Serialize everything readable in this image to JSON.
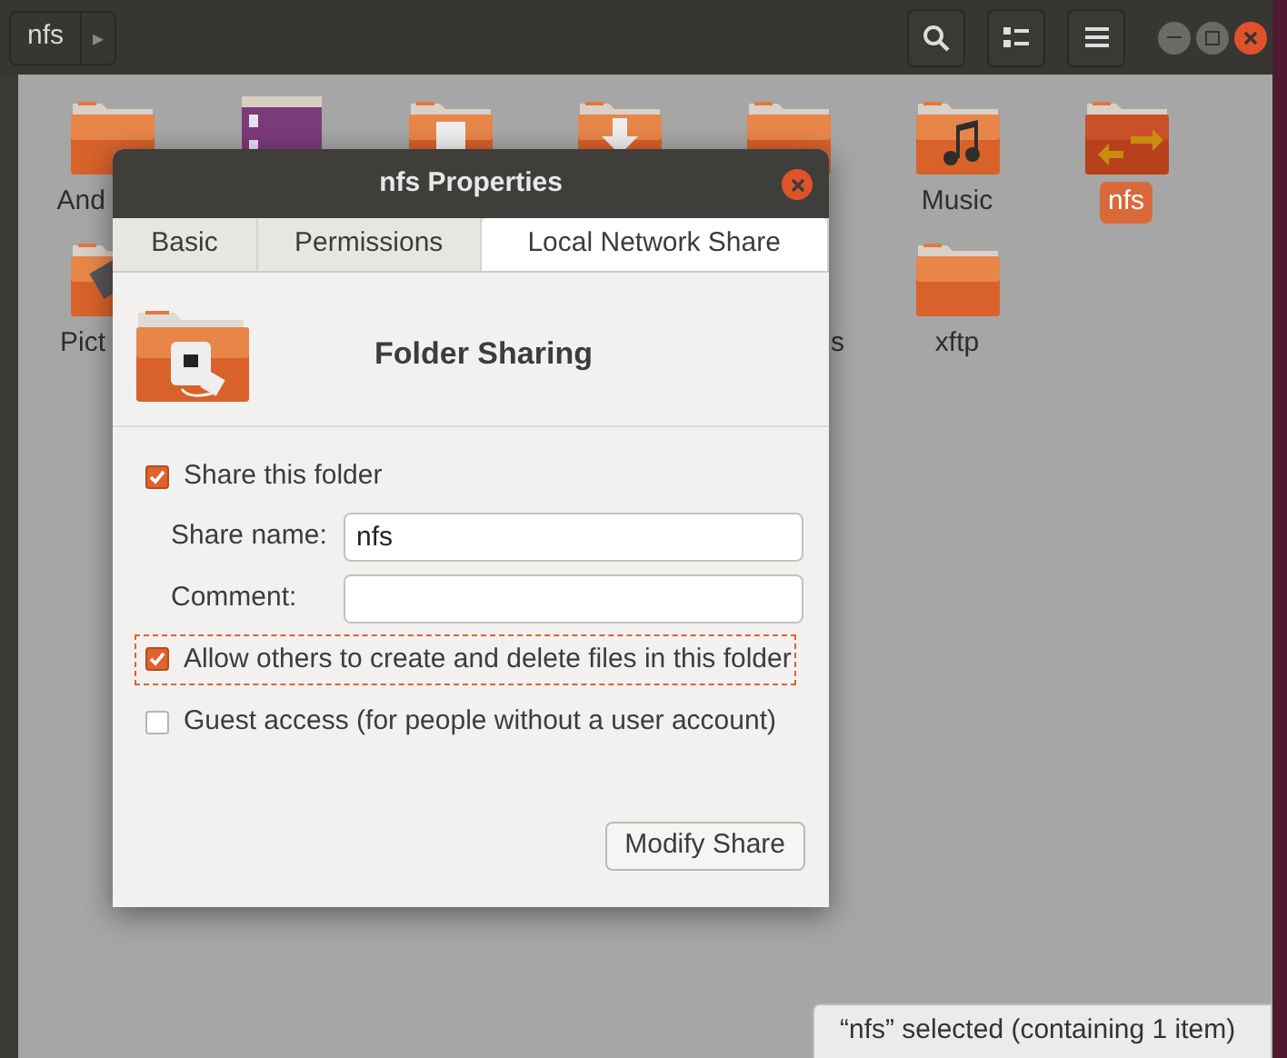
{
  "header": {
    "path": "nfs",
    "path_arrow": "▸"
  },
  "files": [
    [
      {
        "label": "And",
        "kind": "folder",
        "selected": false
      },
      {
        "kind": "video"
      },
      {
        "kind": "document"
      },
      {
        "kind": "download"
      },
      {
        "kind": "folder"
      },
      {
        "label": "Music",
        "kind": "music",
        "selected": false
      },
      {
        "label": "nfs",
        "kind": "shared",
        "selected": true
      }
    ],
    [
      {
        "label": "Pict",
        "kind": "pictures",
        "selected": false
      },
      {
        "kind": "none"
      },
      {
        "kind": "none"
      },
      {
        "kind": "none"
      },
      {
        "label": "s",
        "kind": "none",
        "selected": false
      },
      {
        "label": "xftp",
        "kind": "folder",
        "selected": false
      }
    ]
  ],
  "dialog": {
    "title": "nfs Properties",
    "tabs": [
      {
        "label": "Basic",
        "selected": false
      },
      {
        "label": "Permissions",
        "selected": false
      },
      {
        "label": "Local Network Share",
        "selected": true
      }
    ],
    "heading": "Folder Sharing",
    "share": {
      "label": "Share this folder",
      "checked": true
    },
    "fields": [
      {
        "label": "Share name:",
        "value": "nfs"
      },
      {
        "label": "Comment:"
      }
    ],
    "options": [
      {
        "label": "Allow others to create and delete files in this folder",
        "checked": true,
        "focused": true
      },
      {
        "label": "Guest access (for people without a user account)",
        "checked": false,
        "focused": false
      }
    ],
    "button": "Modify Share"
  },
  "status_bar": "“nfs” selected (containing 1 item)"
}
